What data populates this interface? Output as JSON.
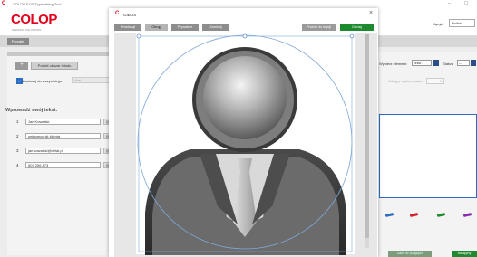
{
  "app": {
    "title": "COLOP EOS Typesetting Tool",
    "brand": "COLOP",
    "brand_sub": "MARKING SOLUTIONS",
    "language_label": "Język:",
    "language_value": "Polish",
    "toolbar_tab": "Początek"
  },
  "left_panel": {
    "preset_button": "Powiel obszar tekstu",
    "apply_all_label": "Zastosuj do wszystkiego",
    "apply_all_value": "Arial",
    "input_title": "Wprowadź swój tekst:",
    "rows": [
      {
        "num": "1",
        "value": "Jan Kowalski"
      },
      {
        "num": "2",
        "value": "pełnomocnik klienta"
      },
      {
        "num": "3",
        "value": "jan.kowalski@detal.pl"
      },
      {
        "num": "4",
        "value": "503 256 873"
      }
    ]
  },
  "right_panel": {
    "element_label": "Wybierz element:",
    "element_value": "Tekst 1",
    "status_label": "Status",
    "status_value": "---",
    "spacing_label": "Odstępy między znakami",
    "spacing_value": "0",
    "next_button": "Dalej do podglądu",
    "finish_button": "Następny"
  },
  "dialog": {
    "title": "GIBOS",
    "close": "×",
    "tabs": [
      "Prostokąt",
      "Okrąg",
      "Prywatnie",
      "Zamknij"
    ],
    "active_tab": "Okrąg",
    "reset_button": "Przeróć do edycji",
    "add_button": "Dodaj"
  },
  "colors": {
    "brand_red": "#e2001a",
    "accent_blue": "#2b6dc1",
    "primary_green": "#1e8a2f"
  },
  "icons": {
    "app_logo": "colop-c-logo",
    "close": "close-icon",
    "placeholder_avatar": "user-silhouette-icon"
  }
}
